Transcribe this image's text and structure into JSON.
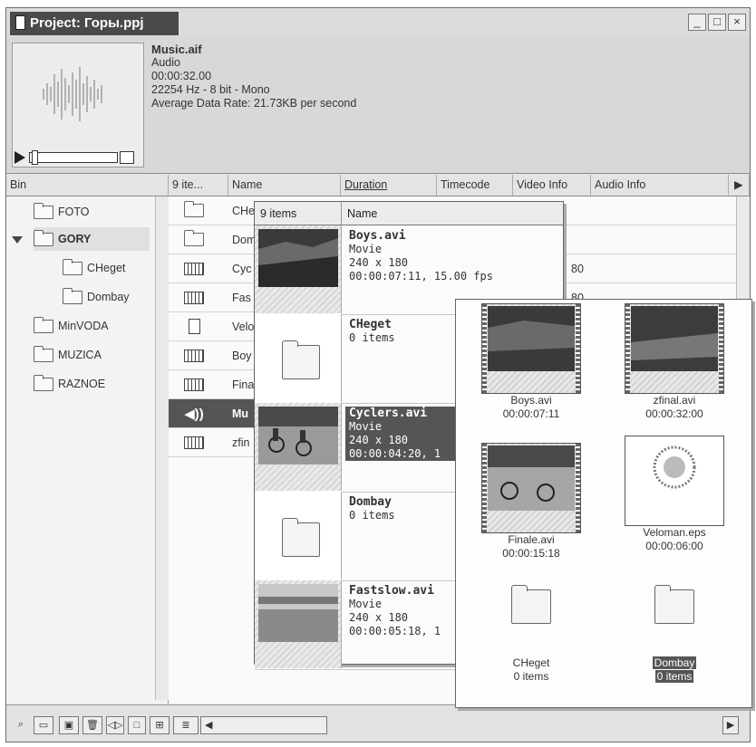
{
  "window": {
    "title": "Project: Горы.ppj",
    "buttons": [
      "_",
      "□",
      "×"
    ]
  },
  "preview": {
    "file_name": "Music.aif",
    "type": "Audio",
    "duration": "00:00:32.00",
    "format": "22254 Hz - 8 bit - Mono",
    "data_rate": "Average Data Rate: 21.73KB per second"
  },
  "columns": {
    "bin": "Bin",
    "count": "9 ite...",
    "name": "Name",
    "duration": "Duration",
    "timecode": "Timecode",
    "video_info": "Video Info",
    "audio_info": "Audio Info"
  },
  "bins": [
    {
      "label": "FOTO"
    },
    {
      "label": "GORY"
    },
    {
      "label": "CHeget"
    },
    {
      "label": "Dombay"
    },
    {
      "label": "MinVODA"
    },
    {
      "label": "MUZICA"
    },
    {
      "label": "RAZNOE"
    }
  ],
  "list_rows": [
    {
      "icon": "folder-icon",
      "name": "CHe"
    },
    {
      "icon": "folder-icon",
      "name": "Dom"
    },
    {
      "icon": "film-icon",
      "name": "Cyc"
    },
    {
      "icon": "film-icon",
      "name": "Fas"
    },
    {
      "icon": "document-icon",
      "name": "Velo"
    },
    {
      "icon": "film-icon",
      "name": "Boy"
    },
    {
      "icon": "film-icon",
      "name": "Fina"
    },
    {
      "icon": "speaker-icon",
      "name": "Mu"
    },
    {
      "icon": "film-audio-icon",
      "name": "zfin"
    }
  ],
  "list_fragments": {
    "r3": "80",
    "r4": "80"
  },
  "thumbnail_view": {
    "count": "9 items",
    "name_header": "Name",
    "rows": [
      {
        "name": "Boys.avi",
        "l2": "Movie",
        "l3": "240 x 180",
        "l4": "00:00:07:11, 15.00 fps"
      },
      {
        "name": "CHeget",
        "l2": "0 items",
        "l3": "",
        "l4": ""
      },
      {
        "name": "Cyclers.avi",
        "l2": "Movie",
        "l3": "240 x 180",
        "l4": "00:00:04:20, 1"
      },
      {
        "name": "Dombay",
        "l2": "0 items",
        "l3": "",
        "l4": ""
      },
      {
        "name": "Fastslow.avi",
        "l2": "Movie",
        "l3": "240 x 180",
        "l4": "00:00:05:18, 1"
      }
    ]
  },
  "icon_view": [
    {
      "name": "Boys.avi",
      "sub": "00:00:07:11"
    },
    {
      "name": "zfinal.avi",
      "sub": "00:00:32:00"
    },
    {
      "name": "Finale.avi",
      "sub": "00:00:15:18"
    },
    {
      "name": "Veloman.eps",
      "sub": "00:00:06:00"
    },
    {
      "name": "CHeget",
      "sub": "0 items"
    },
    {
      "name": "Dombay",
      "sub": "0 items"
    }
  ],
  "toolbar": {
    "find": "find-icon",
    "new_bin": "new-bin-icon",
    "new_item": "new-item-icon",
    "delete": "trash-icon"
  }
}
